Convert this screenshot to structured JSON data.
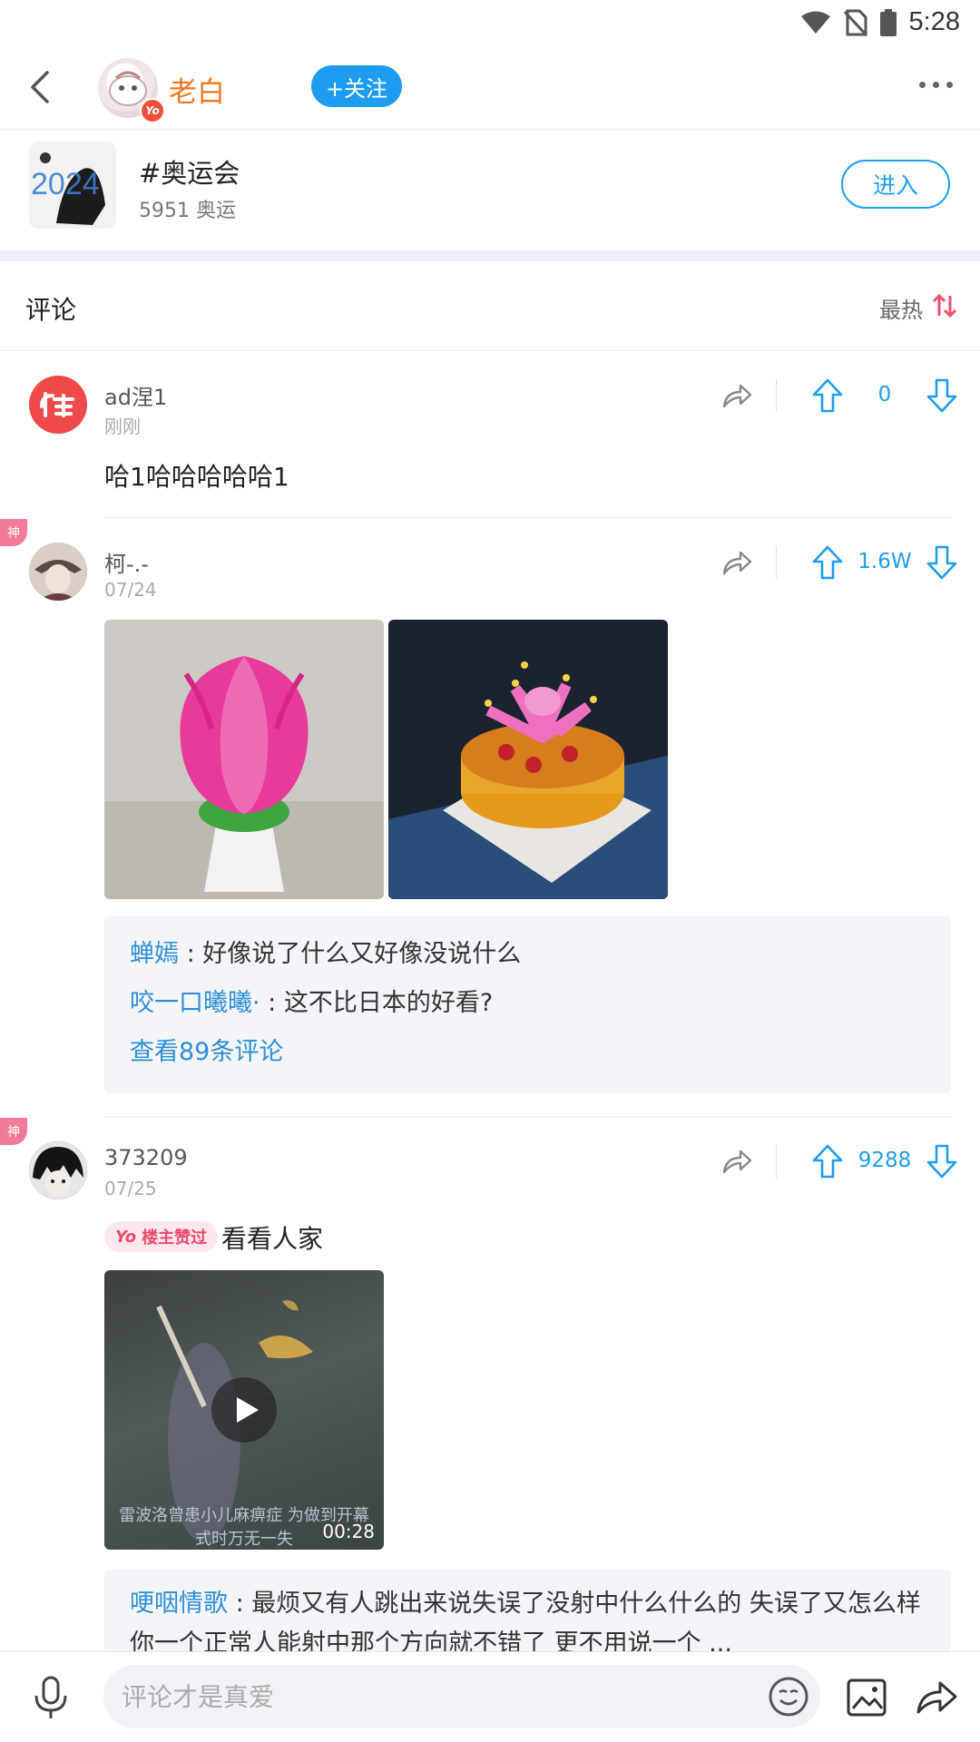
{
  "status_bar": {
    "time": "5:28"
  },
  "header": {
    "author_name": "老白",
    "yo_badge": "Yo",
    "follow_label": "+关注"
  },
  "topic": {
    "title": "#奥运会",
    "subtitle": "5951 奥运",
    "thumb_text": "2024",
    "enter_label": "进入"
  },
  "comments_section": {
    "title": "评论",
    "sort_label": "最热"
  },
  "comments": [
    {
      "name": "ad涅1",
      "time": "刚刚",
      "text": "哈1哈哈哈哈哈1",
      "likes": "0"
    },
    {
      "badge": "神",
      "name": "柯-.-",
      "time": "07/24",
      "likes": "1.6W",
      "replies": [
        {
          "user": "蝉嫣",
          "text": " : 好像说了什么又好像没说什么"
        },
        {
          "user": "咬一口曦曦·",
          "text": " : 这不比日本的好看?"
        }
      ],
      "more_replies": "查看89条评论"
    },
    {
      "badge": "神",
      "name": "373209",
      "time": "07/25",
      "likes": "9288",
      "praise_yo": "Yo",
      "praise_label": "楼主赞过",
      "text": "看看人家",
      "video_duration": "00:28",
      "video_caption": "雷波洛曾患小儿麻痹症 为做到开幕式时万无一失",
      "replies": [
        {
          "user": "哽咽情歌",
          "text": " : 最烦又有人跳出来说失误了没射中什么什么的  失误了又怎么样 你一个正常人能射中那个方向就不错了 更不用说一个 ..."
        }
      ]
    }
  ],
  "bottom_bar": {
    "input_placeholder": "评论才是真爱"
  },
  "colors": {
    "accent": "#1e9cf0",
    "author_orange": "#f3761c",
    "god_badge": "#f47a9a",
    "reply_user": "#2e8fd8"
  }
}
